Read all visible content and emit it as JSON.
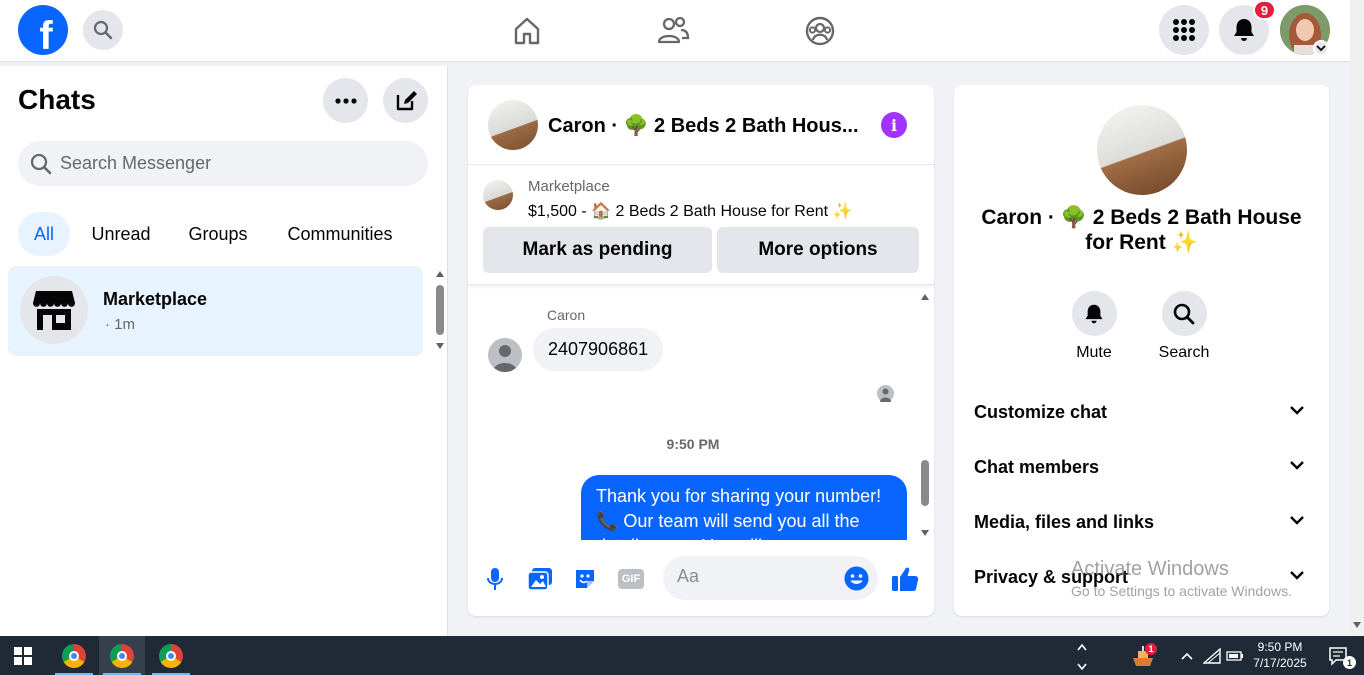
{
  "topbar": {
    "logo_letter": "f",
    "notifications_count": "9",
    "colors": {
      "brand": "#0866ff",
      "badge": "#e41e3f"
    },
    "icons": [
      "search-icon",
      "home-icon",
      "friends-icon",
      "groups-icon",
      "menu-grid-icon",
      "bell-icon"
    ]
  },
  "sidebar": {
    "title": "Chats",
    "search_placeholder": "Search Messenger",
    "tabs": [
      {
        "label": "All",
        "active": true
      },
      {
        "label": "Unread",
        "active": false
      },
      {
        "label": "Groups",
        "active": false
      },
      {
        "label": "Communities",
        "active": false
      }
    ],
    "chats": [
      {
        "name": "Marketplace",
        "time": "· 1m"
      }
    ]
  },
  "conversation": {
    "title": "Caron · 🌳 2 Beds 2 Bath Hous...",
    "listing": {
      "label": "Marketplace",
      "price_line": "$1,500 - 🏠 2 Beds 2 Bath House for Rent ✨",
      "buttons": [
        "Mark as pending",
        "More options"
      ]
    },
    "messages": {
      "sender": "Caron",
      "incoming": "2407906861",
      "time_separator": "9:50 PM",
      "outgoing": "Thank you for sharing your number! 📞 Our team will send you all the details soon. You will"
    },
    "composer_placeholder": "Aa",
    "composer_icons": [
      "microphone-icon",
      "photo-icon",
      "sticker-icon",
      "gif-icon",
      "emoji-icon",
      "thumbs-up-icon"
    ],
    "gif_label": "GIF"
  },
  "info_panel": {
    "name": "Caron · 🌳 2 Beds 2 Bath House for Rent ✨",
    "actions": [
      {
        "label": "Mute",
        "icon": "bell-icon"
      },
      {
        "label": "Search",
        "icon": "search-icon"
      }
    ],
    "sections": [
      "Customize chat",
      "Chat members",
      "Media, files and links",
      "Privacy & support"
    ]
  },
  "watermark": {
    "title": "Activate Windows",
    "subtitle": "Go to Settings to activate Windows."
  },
  "taskbar": {
    "time": "9:50 PM",
    "date": "7/17/2025",
    "notification_count": "1",
    "app_badge": "1"
  }
}
